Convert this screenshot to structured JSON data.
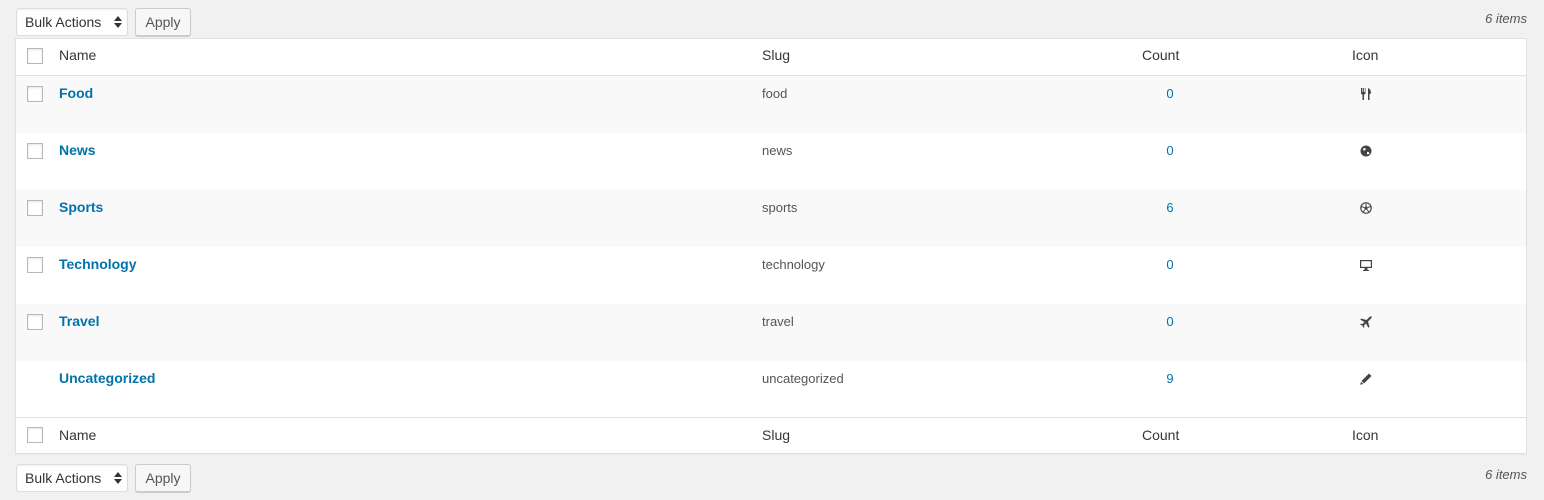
{
  "tablenav_top": {
    "bulk_actions": "Bulk Actions",
    "apply": "Apply",
    "items_count": "6 items"
  },
  "tablenav_bottom": {
    "bulk_actions": "Bulk Actions",
    "apply": "Apply",
    "items_count": "6 items"
  },
  "columns": {
    "name": "Name",
    "slug": "Slug",
    "count": "Count",
    "icon": "Icon"
  },
  "rows": [
    {
      "name": "Food",
      "slug": "food",
      "count": "0",
      "icon": "utensils-icon"
    },
    {
      "name": "News",
      "slug": "news",
      "count": "0",
      "icon": "globe-icon"
    },
    {
      "name": "Sports",
      "slug": "sports",
      "count": "6",
      "icon": "soccer-ball-icon"
    },
    {
      "name": "Technology",
      "slug": "technology",
      "count": "0",
      "icon": "desktop-icon"
    },
    {
      "name": "Travel",
      "slug": "travel",
      "count": "0",
      "icon": "airplane-icon"
    },
    {
      "name": "Uncategorized",
      "slug": "uncategorized",
      "count": "9",
      "icon": "pencil-icon"
    }
  ],
  "colors": {
    "link": "#0073aa",
    "text": "#444444",
    "background": "#f1f1f1",
    "row_alt": "#f9f9f9"
  }
}
